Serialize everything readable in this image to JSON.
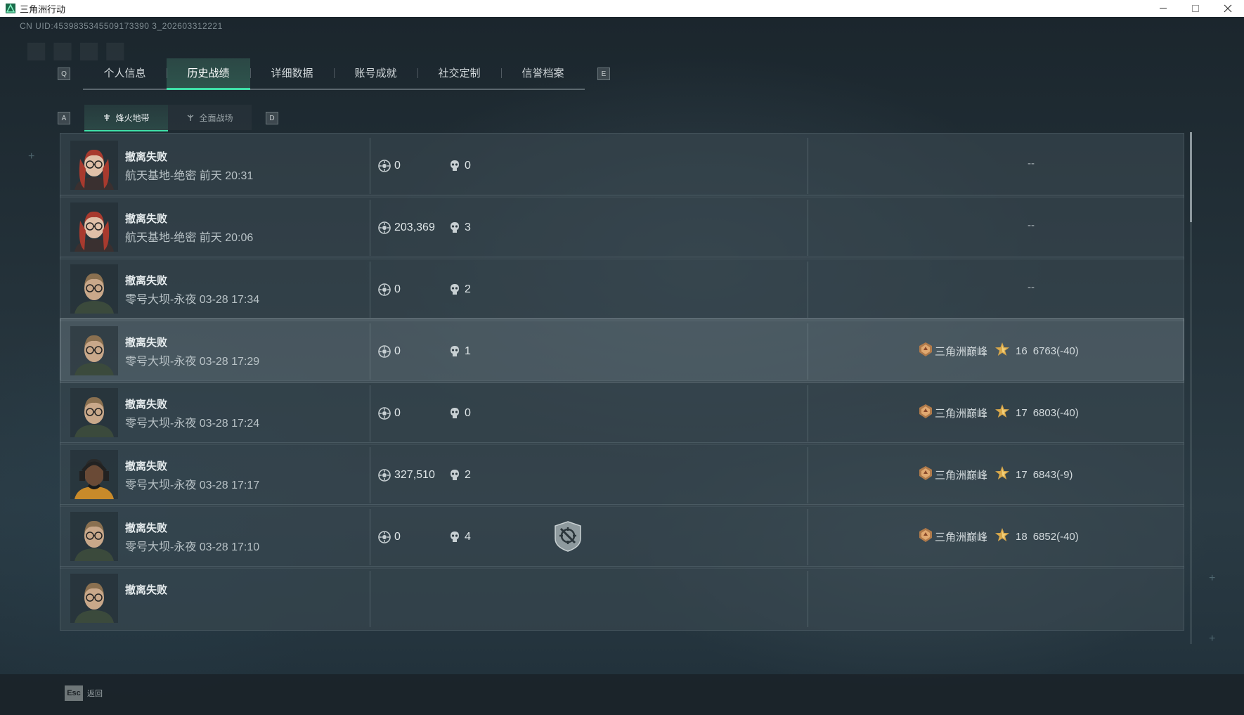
{
  "window": {
    "title": "三角洲行动",
    "controls": [
      "minimize",
      "maximize",
      "close"
    ]
  },
  "header": {
    "uid": "CN UID:4539835345509173390 3_202603312221"
  },
  "tabs": {
    "left_key": "Q",
    "right_key": "E",
    "items": [
      {
        "label": "个人信息"
      },
      {
        "label": "历史战绩",
        "active": true
      },
      {
        "label": "详细数据"
      },
      {
        "label": "账号成就"
      },
      {
        "label": "社交定制"
      },
      {
        "label": "信誉档案"
      }
    ]
  },
  "subtabs": {
    "left_key": "A",
    "right_key": "D",
    "items": [
      {
        "label": "烽火地带",
        "active": true,
        "icon": "flame-mode-icon"
      },
      {
        "label": "全面战场",
        "icon": "battlefield-mode-icon"
      }
    ]
  },
  "matches": [
    {
      "result": "撤离失败",
      "map": "航天基地-绝密 前天 20:31",
      "value": "0",
      "kills": "0",
      "rank": "--",
      "avatar": "red-hair-operator"
    },
    {
      "result": "撤离失败",
      "map": "航天基地-绝密 前天 20:06",
      "value": "203,369",
      "kills": "3",
      "rank": "--",
      "avatar": "red-hair-operator"
    },
    {
      "result": "撤离失败",
      "map": "零号大坝-永夜 03-28 17:34",
      "value": "0",
      "kills": "2",
      "rank": "--",
      "avatar": "glasses-operator"
    },
    {
      "result": "撤离失败",
      "map": "零号大坝-永夜 03-28 17:29",
      "value": "0",
      "kills": "1",
      "rank_name": "三角洲巅峰",
      "level": "16",
      "score": "6763(-40)",
      "avatar": "glasses-operator",
      "highlighted": true
    },
    {
      "result": "撤离失败",
      "map": "零号大坝-永夜 03-28 17:24",
      "value": "0",
      "kills": "0",
      "rank_name": "三角洲巅峰",
      "level": "17",
      "score": "6803(-40)",
      "avatar": "glasses-operator"
    },
    {
      "result": "撤离失败",
      "map": "零号大坝-永夜 03-28 17:17",
      "value": "327,510",
      "kills": "2",
      "rank_name": "三角洲巅峰",
      "level": "17",
      "score": "6843(-9)",
      "avatar": "headset-operator"
    },
    {
      "result": "撤离失败",
      "map": "零号大坝-永夜 03-28 17:10",
      "value": "0",
      "kills": "4",
      "rank_name": "三角洲巅峰",
      "level": "18",
      "score": "6852(-40)",
      "avatar": "glasses-operator",
      "badge": "no-aim-shield-icon"
    },
    {
      "result": "撤离失败",
      "map": "",
      "value": "",
      "kills": "",
      "rank": "",
      "avatar": "glasses-operator",
      "partial": true
    }
  ],
  "footer": {
    "esc_key": "Esc",
    "back_label": "返回"
  },
  "colors": {
    "accent": "#3fe0a8",
    "row_bg": "#3a4850",
    "row_highlight": "#5f6e76",
    "text": "#d7dde0"
  }
}
